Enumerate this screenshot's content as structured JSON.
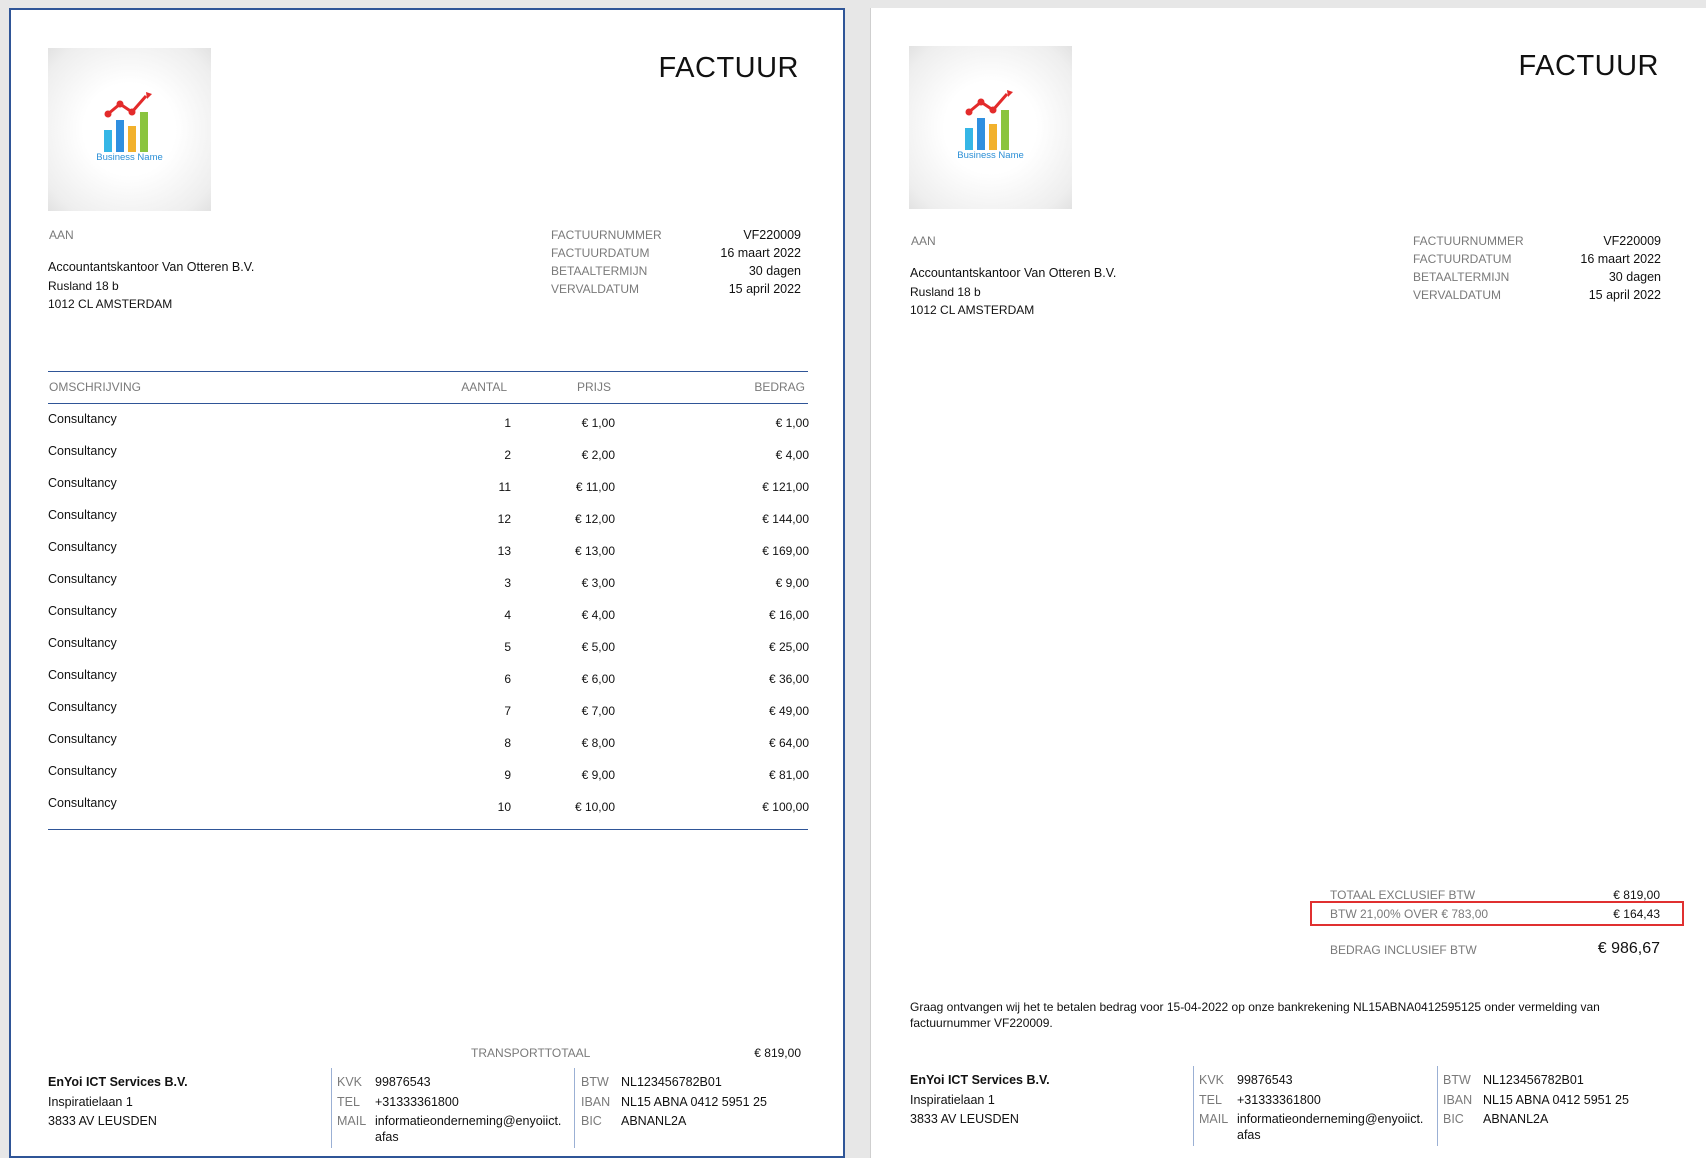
{
  "invoice": {
    "title": "FACTUUR",
    "logo_text": "Business Name",
    "to_label": "AAN",
    "recipient": {
      "name": "Accountantskantoor Van Otteren B.V.",
      "street": "Rusland 18 b",
      "city": "1012 CL AMSTERDAM"
    },
    "meta": [
      {
        "label": "FACTUURNUMMER",
        "value": "VF220009"
      },
      {
        "label": "FACTUURDATUM",
        "value": "16 maart 2022"
      },
      {
        "label": "BETAALTERMIJN",
        "value": "30 dagen"
      },
      {
        "label": "VERVALDATUM",
        "value": "15 april 2022"
      }
    ],
    "table": {
      "headers": {
        "description": "OMSCHRIJVING",
        "qty": "AANTAL",
        "price": "PRIJS",
        "amount": "BEDRAG"
      },
      "rows": [
        {
          "description": "Consultancy",
          "qty": "1",
          "price": "€ 1,00",
          "amount": "€ 1,00"
        },
        {
          "description": "Consultancy",
          "qty": "2",
          "price": "€ 2,00",
          "amount": "€ 4,00"
        },
        {
          "description": "Consultancy",
          "qty": "11",
          "price": "€ 11,00",
          "amount": "€ 121,00"
        },
        {
          "description": "Consultancy",
          "qty": "12",
          "price": "€ 12,00",
          "amount": "€ 144,00"
        },
        {
          "description": "Consultancy",
          "qty": "13",
          "price": "€ 13,00",
          "amount": "€ 169,00"
        },
        {
          "description": "Consultancy",
          "qty": "3",
          "price": "€ 3,00",
          "amount": "€ 9,00"
        },
        {
          "description": "Consultancy",
          "qty": "4",
          "price": "€ 4,00",
          "amount": "€ 16,00"
        },
        {
          "description": "Consultancy",
          "qty": "5",
          "price": "€ 5,00",
          "amount": "€ 25,00"
        },
        {
          "description": "Consultancy",
          "qty": "6",
          "price": "€ 6,00",
          "amount": "€ 36,00"
        },
        {
          "description": "Consultancy",
          "qty": "7",
          "price": "€ 7,00",
          "amount": "€ 49,00"
        },
        {
          "description": "Consultancy",
          "qty": "8",
          "price": "€ 8,00",
          "amount": "€ 64,00"
        },
        {
          "description": "Consultancy",
          "qty": "9",
          "price": "€ 9,00",
          "amount": "€ 81,00"
        },
        {
          "description": "Consultancy",
          "qty": "10",
          "price": "€ 10,00",
          "amount": "€ 100,00"
        }
      ]
    },
    "transport": {
      "label": "TRANSPORTTOTAAL",
      "value": "€ 819,00"
    },
    "totals": {
      "excl_label": "TOTAAL EXCLUSIEF BTW",
      "excl_value": "€ 819,00",
      "vat_label": "BTW 21,00% OVER € 783,00",
      "vat_value": "€ 164,43",
      "incl_label": "BEDRAG INCLUSIEF BTW",
      "incl_value": "€ 986,67"
    },
    "payment_note": "Graag ontvangen wij het te betalen bedrag voor 15-04-2022 op onze bankrekening NL15ABNA0412595125 onder vermelding van factuurnummer VF220009.",
    "company": {
      "name": "EnYoi ICT Services B.V.",
      "street": "Inspiratielaan 1",
      "city": "3833 AV LEUSDEN",
      "kvk_label": "KVK",
      "kvk": "99876543",
      "tel_label": "TEL",
      "tel": "+31333361800",
      "mail_label": "MAIL",
      "mail_line1": "informatieonderneming@enyoiict.",
      "mail_line2": "afas",
      "btw_label": "BTW",
      "btw": "NL123456782B01",
      "iban_label": "IBAN",
      "iban": "NL15 ABNA 0412 5951 25",
      "bic_label": "BIC",
      "bic": "ABNANL2A"
    }
  },
  "colors": {
    "accent": "#2f5597",
    "highlight": "#e03030"
  }
}
